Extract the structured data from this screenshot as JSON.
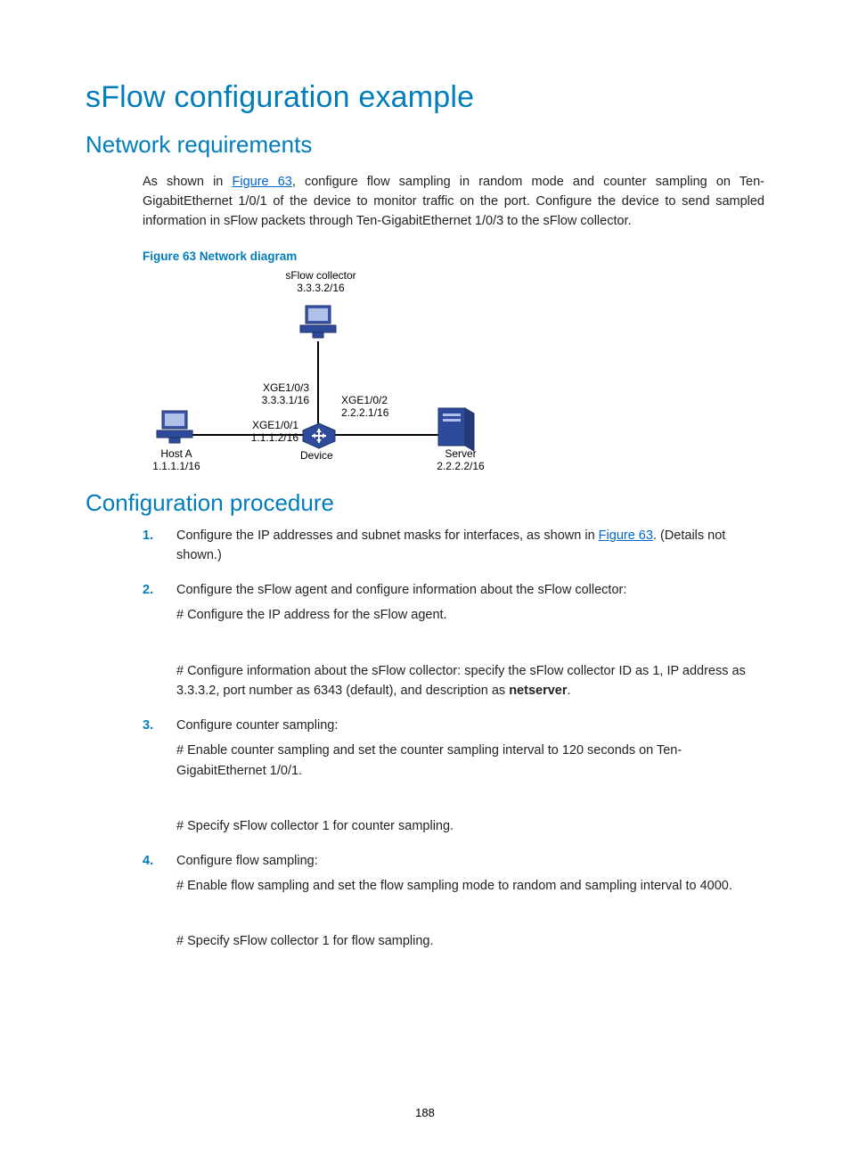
{
  "title": "sFlow configuration example",
  "page_number": "188",
  "network_req": {
    "heading": "Network requirements",
    "para_pre": "As shown in ",
    "fig_link": "Figure 63",
    "para_post": ", configure flow sampling in random mode and counter sampling on Ten-GigabitEthernet 1/0/1 of the device to monitor traffic on the port. Configure the device to send sampled information in sFlow packets through Ten-GigabitEthernet 1/0/3 to the sFlow collector.",
    "fig_caption": "Figure 63 Network diagram"
  },
  "diagram": {
    "collector_label": "sFlow collector",
    "collector_ip": "3.3.3.2/16",
    "xge3": "XGE1/0/3",
    "xge3_ip": "3.3.3.1/16",
    "xge2": "XGE1/0/2",
    "xge2_ip": "2.2.2.1/16",
    "xge1": "XGE1/0/1",
    "xge1_ip": "1.1.1.2/16",
    "host_a": "Host A",
    "host_a_ip": "1.1.1.1/16",
    "device": "Device",
    "server": "Server",
    "server_ip": "2.2.2.2/16"
  },
  "config": {
    "heading": "Configuration procedure",
    "steps": [
      {
        "num": "1.",
        "text_pre": "Configure the IP addresses and subnet masks for interfaces, as shown in ",
        "link": "Figure 63",
        "text_post": ". (Details not shown.)"
      },
      {
        "num": "2.",
        "lead": "Configure the sFlow agent and configure information about the sFlow collector:",
        "sub1": "# Configure the IP address for the sFlow agent.",
        "sub2_pre": "# Configure information about the sFlow collector: specify the sFlow collector ID as 1, IP address as 3.3.3.2, port number as 6343 (default), and description as ",
        "sub2_bold": "netserver",
        "sub2_post": "."
      },
      {
        "num": "3.",
        "lead": "Configure counter sampling:",
        "sub1": "# Enable counter sampling and set the counter sampling interval to 120 seconds on Ten-GigabitEthernet 1/0/1.",
        "sub2": "# Specify sFlow collector 1 for counter sampling."
      },
      {
        "num": "4.",
        "lead": "Configure flow sampling:",
        "sub1": "# Enable flow sampling and set the flow sampling mode to random and sampling interval to 4000.",
        "sub2": "# Specify sFlow collector 1 for flow sampling."
      }
    ]
  }
}
